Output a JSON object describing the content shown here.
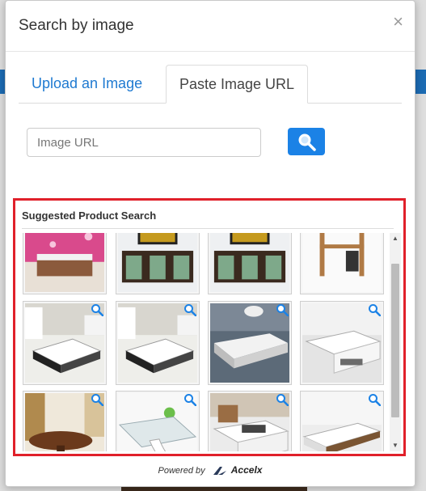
{
  "modal": {
    "title": "Search by image",
    "close_label": "×"
  },
  "tabs": [
    {
      "label": "Upload an Image",
      "active": false
    },
    {
      "label": "Paste Image URL",
      "active": true
    }
  ],
  "url_field": {
    "placeholder": "Image URL",
    "value": ""
  },
  "search_button": {
    "icon": "search-icon"
  },
  "suggested": {
    "title": "Suggested Product Search",
    "items": [
      {
        "name": "pink-wallpaper-bedroom",
        "zoom": false
      },
      {
        "name": "tv-stand-wood-glass",
        "zoom": false
      },
      {
        "name": "tv-stand-wood-glass",
        "zoom": false
      },
      {
        "name": "wooden-computer-desk",
        "zoom": false
      },
      {
        "name": "white-black-coffee-table",
        "zoom": true
      },
      {
        "name": "white-black-coffee-table",
        "zoom": true
      },
      {
        "name": "gray-white-coffee-table",
        "zoom": true
      },
      {
        "name": "white-drawer-coffee-table",
        "zoom": true
      },
      {
        "name": "oval-wood-coffee-table",
        "zoom": true
      },
      {
        "name": "glass-coffee-table",
        "zoom": true
      },
      {
        "name": "white-lift-top-coffee-table",
        "zoom": true
      },
      {
        "name": "white-wood-coffee-table",
        "zoom": true
      }
    ]
  },
  "footer": {
    "powered_by": "Powered by",
    "brand": "Accelx"
  },
  "colors": {
    "accent": "#1b82e6",
    "highlight_border": "#e0202a",
    "tab_link": "#1f7ad1"
  }
}
